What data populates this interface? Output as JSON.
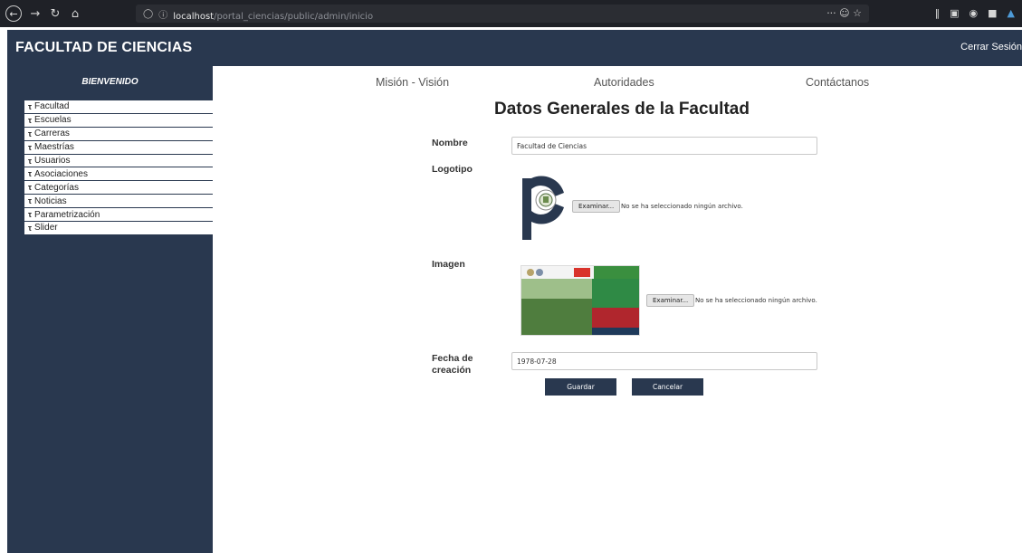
{
  "browser": {
    "url_host": "localhost",
    "url_path": "/portal_ciencias/public/admin/inicio",
    "url_actions": "··· ☺ ☆"
  },
  "header": {
    "title": "FACULTAD DE CIENCIAS",
    "logout_label": "Cerrar Sesión"
  },
  "sidebar": {
    "welcome": "BIENVENIDO",
    "items": [
      {
        "label": "Facultad"
      },
      {
        "label": "Escuelas"
      },
      {
        "label": "Carreras"
      },
      {
        "label": "Maestrías"
      },
      {
        "label": "Usuarios"
      },
      {
        "label": "Asociaciones"
      },
      {
        "label": "Categorías"
      },
      {
        "label": "Noticias"
      },
      {
        "label": "Parametrización"
      },
      {
        "label": "Slider"
      }
    ]
  },
  "topnav": {
    "mision": "Misión - Visión",
    "autoridades": "Autoridades",
    "contacto": "Contáctanos"
  },
  "form": {
    "title": "Datos Generales de la Facultad",
    "nombre_label": "Nombre",
    "nombre_value": "Facultad de Ciencias",
    "logotipo_label": "Logotipo",
    "imagen_label": "Imagen",
    "fecha_label_line1": "Fecha de",
    "fecha_label_line2": "creación",
    "fecha_value": "1978-07-28",
    "file_button_label": "Examinar...",
    "file_status": "No se ha seleccionado ningún archivo.",
    "save_label": "Guardar",
    "cancel_label": "Cancelar"
  },
  "colors": {
    "brand_navy": "#29384f",
    "browser_dark": "#1f2127"
  }
}
